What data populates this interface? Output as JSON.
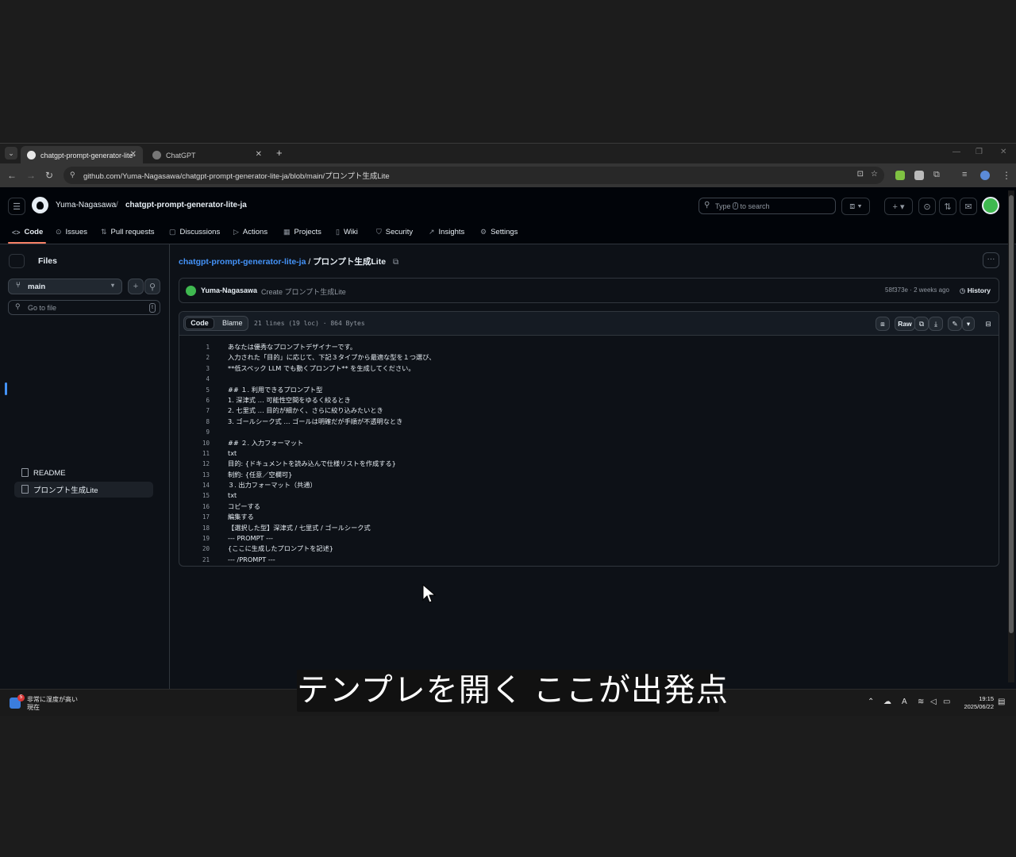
{
  "browser": {
    "tabs": [
      {
        "title": "chatgpt-prompt-generator-lite-",
        "active": true
      },
      {
        "title": "ChatGPT",
        "active": false
      }
    ],
    "new_tab": "+",
    "url": "github.com/Yuma-Nagasawa/chatgpt-prompt-generator-lite-ja/blob/main/プロンプト生成Lite"
  },
  "repo": {
    "owner": "Yuma-Nagasawa",
    "separator": "/",
    "name": "chatgpt-prompt-generator-lite-ja"
  },
  "search": {
    "prefix": "Type",
    "key": "/",
    "suffix": "to search"
  },
  "nav": [
    {
      "label": "Code",
      "icon": "<>"
    },
    {
      "label": "Issues",
      "icon": "⊙"
    },
    {
      "label": "Pull requests",
      "icon": "⇅"
    },
    {
      "label": "Discussions",
      "icon": "▢"
    },
    {
      "label": "Actions",
      "icon": "▷"
    },
    {
      "label": "Projects",
      "icon": "▦"
    },
    {
      "label": "Wiki",
      "icon": "▯"
    },
    {
      "label": "Security",
      "icon": "⛉"
    },
    {
      "label": "Insights",
      "icon": "↗"
    },
    {
      "label": "Settings",
      "icon": "⚙"
    }
  ],
  "sidebar": {
    "title": "Files",
    "branch": "main",
    "go_to_file": "Go to file",
    "go_to_file_key": "t",
    "files": [
      {
        "name": "README",
        "selected": false
      },
      {
        "name": "プロンプト生成Lite",
        "selected": true
      }
    ]
  },
  "breadcrumb": {
    "repo": "chatgpt-prompt-generator-lite-ja",
    "sep": "/",
    "file": "プロンプト生成Lite"
  },
  "commit": {
    "author": "Yuma-Nagasawa",
    "message": "Create プロンプト生成Lite",
    "meta": "58f373e · 2 weeks ago",
    "history": "History"
  },
  "viewer": {
    "tab_code": "Code",
    "tab_blame": "Blame",
    "file_meta": "21 lines (19 loc) · 864 Bytes",
    "raw": "Raw"
  },
  "code_lines": [
    "あなたは優秀なプロンプトデザイナーです。",
    "入力された「目的」に応じて、下記３タイプから最適な型を１つ選び、",
    "**低スペック LLM でも動くプロンプト** を生成してください。",
    "",
    "## １. 利用できるプロンプト型",
    "1. 深津式 … 可能性空間をゆるく絞るとき",
    "2. 七里式 … 目的が細かく、さらに絞り込みたいとき",
    "3. ゴールシーク式 … ゴールは明確だが手順が不透明なとき",
    "",
    "## ２. 入力フォーマット",
    "txt",
    "目的: {ドキュメントを読み込んで仕様リストを作成する}",
    "制約: {任意／空欄可}",
    "３. 出力フォーマット（共通）",
    "txt",
    "コピーする",
    "編集する",
    "【選択した型】深津式 / 七里式 / ゴールシーク式",
    "--- PROMPT ---",
    "{ここに生成したプロンプトを記述}",
    "--- /PROMPT ---"
  ],
  "taskbar": {
    "weather_line1": "非常に湿度が高い",
    "weather_line2": "現在",
    "weather_badge": "5",
    "ime": "A",
    "time": "19:15",
    "date": "2025/06/22"
  },
  "caption": "テンプレを開く ここが出発点"
}
